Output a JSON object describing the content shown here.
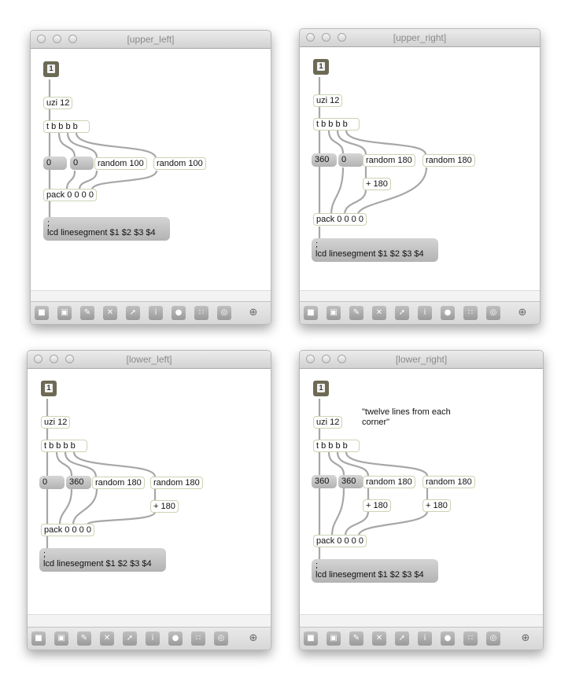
{
  "windows": {
    "upper_left": {
      "title": "[upper_left]",
      "button_label": "1",
      "uzi": "uzi 12",
      "trigger": "t b b b b",
      "num_a": "0",
      "num_b": "0",
      "rand_a": "random 100",
      "rand_b": "random 100",
      "pack": "pack 0 0 0 0",
      "message": "lcd linesegment $1 $2 $3 $4",
      "message_prefix": ";"
    },
    "upper_right": {
      "title": "[upper_right]",
      "button_label": "1",
      "uzi": "uzi 12",
      "trigger": "t b b b b",
      "num_a": "360",
      "num_b": "0",
      "rand_a": "random 180",
      "rand_b": "random 180",
      "plus_a": "+ 180",
      "pack": "pack 0 0 0 0",
      "message": "lcd linesegment $1 $2 $3 $4",
      "message_prefix": ";"
    },
    "lower_left": {
      "title": "[lower_left]",
      "button_label": "1",
      "uzi": "uzi 12",
      "trigger": "t b b b b",
      "num_a": "0",
      "num_b": "360",
      "rand_a": "random 180",
      "rand_b": "random 180",
      "plus_b": "+ 180",
      "pack": "pack 0 0 0 0",
      "message": "lcd linesegment $1 $2 $3 $4",
      "message_prefix": ";"
    },
    "lower_right": {
      "title": "[lower_right]",
      "button_label": "1",
      "comment": "\"twelve lines from each corner\"",
      "uzi": "uzi 12",
      "trigger": "t b b b b",
      "num_a": "360",
      "num_b": "360",
      "rand_a": "random 180",
      "rand_b": "random 180",
      "plus_a": "+ 180",
      "plus_b": "+ 180",
      "pack": "pack 0 0 0 0",
      "message": "lcd linesegment $1 $2 $3 $4",
      "message_prefix": ";"
    }
  },
  "toolbar_icons": [
    "lock-icon",
    "presentation-icon",
    "object-palette-icon",
    "delete-icon",
    "debug-icon",
    "inspector-icon",
    "path-icon",
    "grid-icon",
    "snap-icon",
    "add-icon"
  ]
}
